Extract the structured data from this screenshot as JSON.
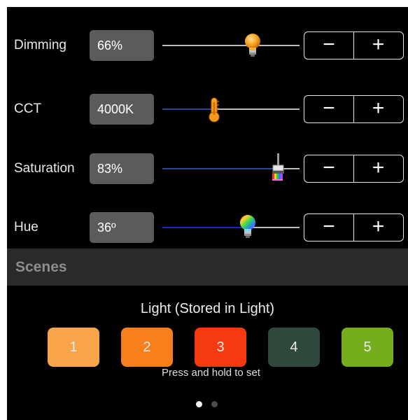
{
  "controls": {
    "dimming": {
      "label": "Dimming",
      "value": "66%",
      "level": 0.66,
      "fill_color": "",
      "icon": "lightbulb-icon"
    },
    "cct": {
      "label": "CCT",
      "value": "4000K",
      "level": 0.38,
      "fill_color": "#2a4a8c",
      "icon": "thermometer-icon"
    },
    "saturation": {
      "label": "Saturation",
      "value": "83%",
      "level": 0.83,
      "fill_color": "#2a4a8c",
      "icon": "paintbrush-icon"
    },
    "hue": {
      "label": "Hue",
      "value": "36º",
      "level": 0.62,
      "fill_color": "#1a25c8",
      "icon": "rgb-bulb-icon"
    }
  },
  "stepper": {
    "minus": "−",
    "plus": "+"
  },
  "scenes": {
    "title": "Scenes",
    "subtitle": "Light (Stored in Light)",
    "buttons": [
      {
        "label": "1",
        "color": "#f7a44a"
      },
      {
        "label": "2",
        "color": "#f87f1b"
      },
      {
        "label": "3",
        "color": "#f6390e"
      },
      {
        "label": "4",
        "color": "#2f4a3d"
      },
      {
        "label": "5",
        "color": "#75ad1c"
      }
    ],
    "hint": "Press and hold to set"
  },
  "pager": {
    "pages": 2,
    "current": 1
  }
}
